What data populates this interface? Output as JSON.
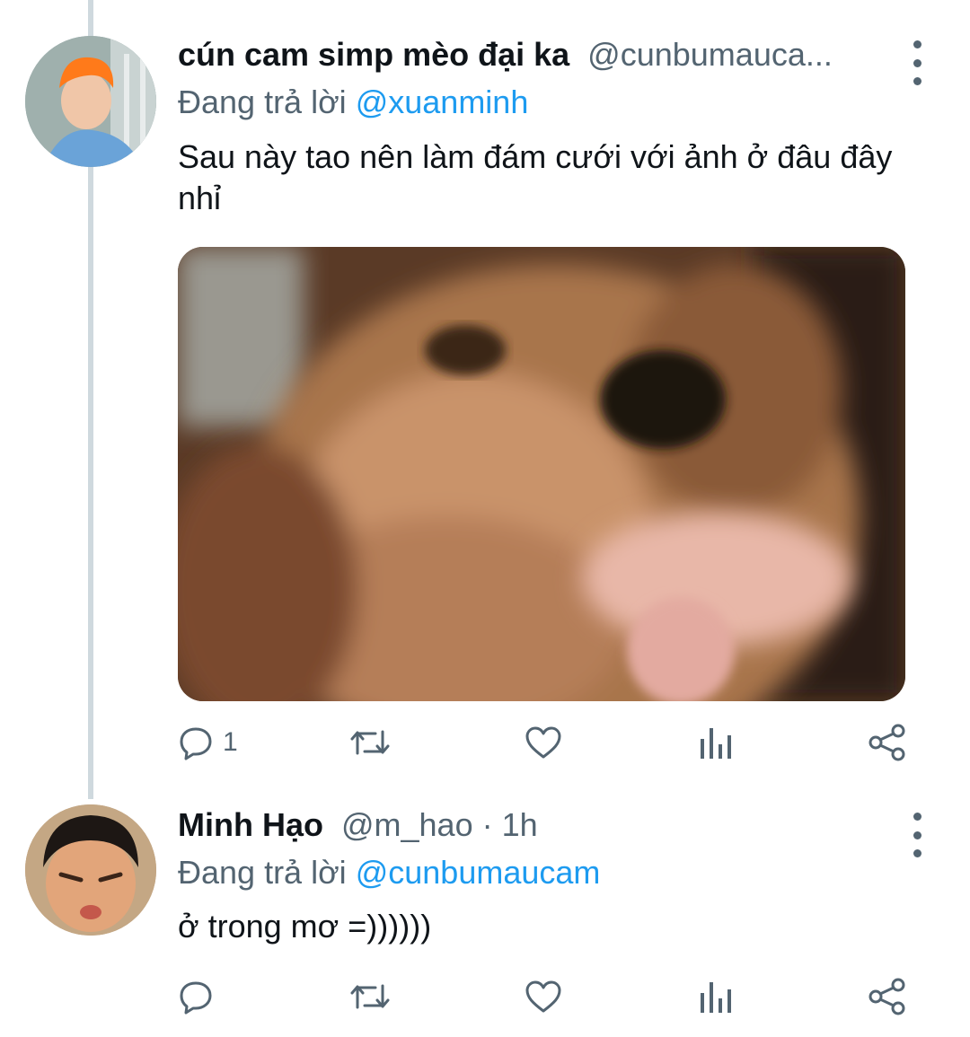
{
  "tweets": [
    {
      "display_name": "cún cam simp mèo đại ka",
      "handle": "@cunbumauca...",
      "reply_prefix": "Đang trả lời",
      "reply_to": "@xuanminh",
      "text": "Sau này tao nên làm đám cưới với ảnh ở đâu đây nhỉ",
      "reply_count": "1",
      "avatar_icon": "avatar-orange-hair-icon",
      "media_description_icon": "dog-photo-image"
    },
    {
      "display_name": "Minh Hạo",
      "handle": "@m_hao · 1h",
      "reply_prefix": "Đang trả lời",
      "reply_to": "@cunbumaucam",
      "text": "ở trong mơ =))))))",
      "avatar_icon": "avatar-child-icon"
    }
  ],
  "icons": [
    "reply-icon",
    "retweet-icon",
    "like-icon",
    "analytics-icon",
    "share-icon",
    "more-options-icon"
  ],
  "colors": {
    "accent": "#1d9bf0",
    "secondary_text": "#536471",
    "primary_text": "#0f1419",
    "thread_line": "#cfd9de"
  }
}
